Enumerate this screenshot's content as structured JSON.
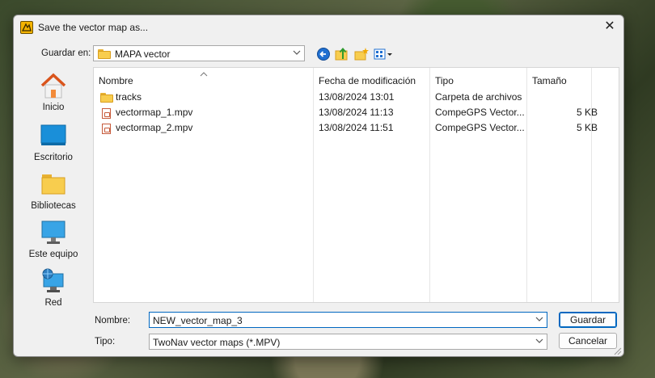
{
  "window": {
    "title": "Save the vector map as...",
    "close_glyph": "✕"
  },
  "toolbar": {
    "save_in_label": "Guardar en:",
    "current_folder": "MAPA vector",
    "icons": [
      "back-icon",
      "up-folder-icon",
      "new-folder-icon",
      "view-menu-icon"
    ]
  },
  "places": [
    {
      "label": "Inicio",
      "icon": "home-icon"
    },
    {
      "label": "Escritorio",
      "icon": "desktop-icon"
    },
    {
      "label": "Bibliotecas",
      "icon": "libraries-icon"
    },
    {
      "label": "Este equipo",
      "icon": "this-pc-icon"
    },
    {
      "label": "Red",
      "icon": "network-icon"
    }
  ],
  "columns": {
    "name": "Nombre",
    "modified": "Fecha de modificación",
    "type": "Tipo",
    "size": "Tamaño"
  },
  "files": [
    {
      "name": "tracks",
      "modified": "13/08/2024 13:01",
      "type": "Carpeta de archivos",
      "size": "",
      "icon": "folder-icon"
    },
    {
      "name": "vectormap_1.mpv",
      "modified": "13/08/2024 11:13",
      "type": "CompeGPS Vector...",
      "size": "5 KB",
      "icon": "mpv-file-icon"
    },
    {
      "name": "vectormap_2.mpv",
      "modified": "13/08/2024 11:51",
      "type": "CompeGPS Vector...",
      "size": "5 KB",
      "icon": "mpv-file-icon"
    }
  ],
  "form": {
    "name_label": "Nombre:",
    "name_value": "NEW_vector_map_3",
    "type_label": "Tipo:",
    "type_value": "TwoNav vector maps (*.MPV)"
  },
  "buttons": {
    "save": "Guardar",
    "cancel": "Cancelar"
  },
  "colors": {
    "accent": "#0067c0",
    "folder": "#f8cd4e",
    "window_bg": "#f0f0f0"
  }
}
